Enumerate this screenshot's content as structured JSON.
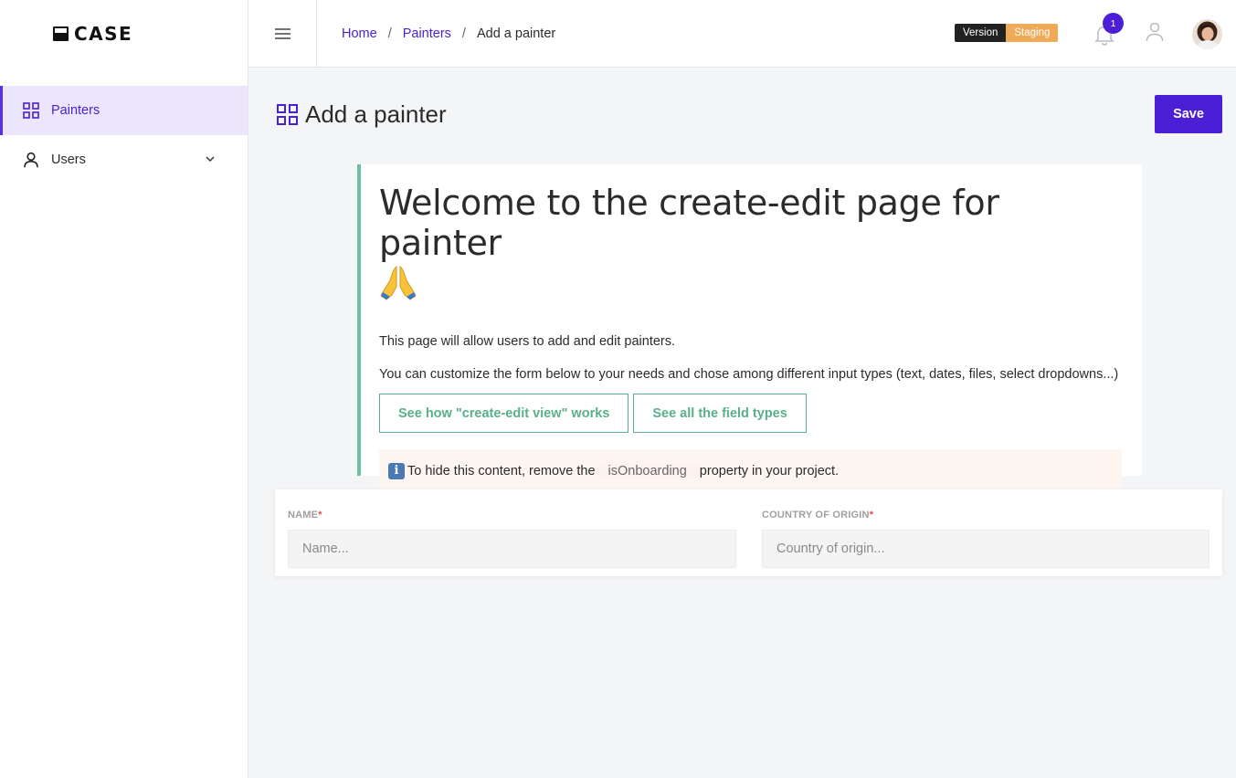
{
  "app": {
    "logo_text": "CASE"
  },
  "sidebar": {
    "items": [
      {
        "label": "Painters",
        "icon": "grid-icon",
        "active": true
      },
      {
        "label": "Users",
        "icon": "user-icon",
        "expandable": true
      }
    ]
  },
  "topbar": {
    "breadcrumb": [
      {
        "label": "Home"
      },
      {
        "label": "Painters"
      },
      {
        "label": "Add a painter"
      }
    ],
    "separator": "/",
    "version_label": "Version",
    "version_value": "Staging",
    "notification_count": "1"
  },
  "page": {
    "title": "Add a painter",
    "save_label": "Save"
  },
  "onboarding": {
    "heading": "Welcome to the create-edit page for painter",
    "heading_emoji": "🙏",
    "paragraph1": "This page will allow users to add and edit painters.",
    "paragraph2": "You can customize the form below to your needs and chose among different input types (text, dates, files, select dropdowns...)",
    "button1": "See how \"create-edit view\" works",
    "button2": "See all the field types",
    "info_icon": "i",
    "info_prefix": "To hide this content, remove the",
    "info_code": "isOnboarding",
    "info_suffix": "property in your project."
  },
  "form": {
    "fields": [
      {
        "label": "NAME",
        "required": "*",
        "placeholder": "Name..."
      },
      {
        "label": "COUNTRY OF ORIGIN",
        "required": "*",
        "placeholder": "Country of origin..."
      }
    ]
  },
  "colors": {
    "accent": "#4a1fd6",
    "green": "#59b08c",
    "staging": "#efab57"
  }
}
